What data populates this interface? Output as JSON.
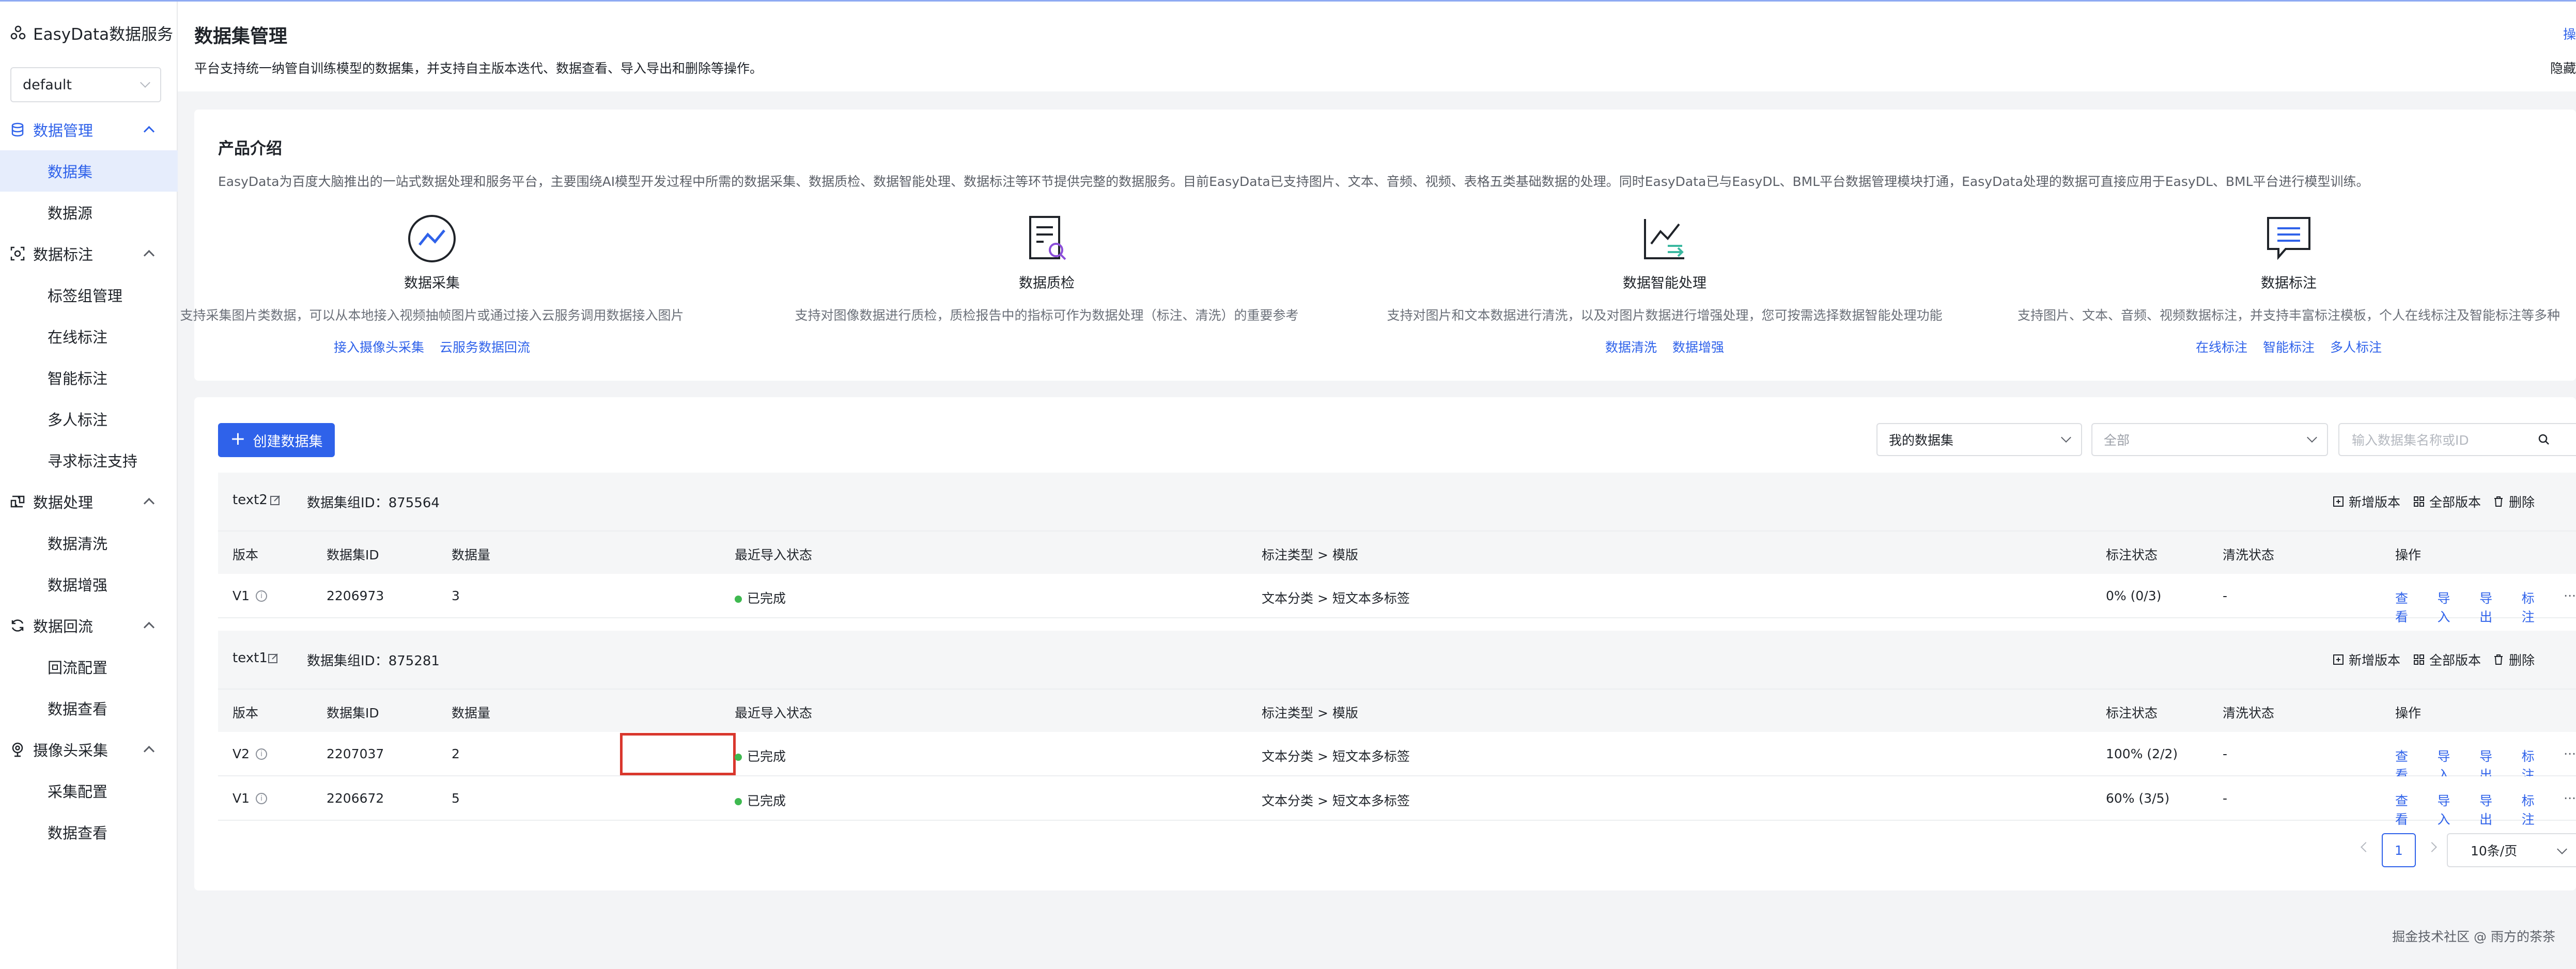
{
  "sidebar": {
    "brand": "EasyData数据服务",
    "workspace": "default",
    "groups": [
      {
        "label": "数据管理",
        "items": [
          "数据集",
          "数据源"
        ]
      },
      {
        "label": "数据标注",
        "items": [
          "标签组管理",
          "在线标注",
          "智能标注",
          "多人标注",
          "寻求标注支持"
        ]
      },
      {
        "label": "数据处理",
        "items": [
          "数据清洗",
          "数据增强"
        ]
      },
      {
        "label": "数据回流",
        "items": [
          "回流配置",
          "数据查看"
        ]
      },
      {
        "label": "摄像头采集",
        "items": [
          "采集配置",
          "数据查看"
        ]
      }
    ]
  },
  "header": {
    "title": "数据集管理",
    "description": "平台支持统一纳管自训练模型的数据集，并支持自主版本迭代、数据查看、导入导出和删除等操作。",
    "hide_link": "隐藏",
    "top_right": "操"
  },
  "intro": {
    "title": "产品介绍",
    "description": "EasyData为百度大脑推出的一站式数据处理和服务平台，主要围绕AI模型开发过程中所需的数据采集、数据质检、数据智能处理、数据标注等环节提供完整的数据服务。目前EasyData已支持图片、文本、音频、视频、表格五类基础数据的处理。同时EasyData已与EasyDL、BML平台数据管理模块打通，EasyData处理的数据可直接应用于EasyDL、BML平台进行模型训练。",
    "features": [
      {
        "name": "数据采集",
        "desc": "支持采集图片类数据，可以从本地接入视频抽帧图片或通过接入云服务调用数据接入图片",
        "links": [
          "接入摄像头采集",
          "云服务数据回流"
        ]
      },
      {
        "name": "数据质检",
        "desc": "支持对图像数据进行质检，质检报告中的指标可作为数据处理（标注、清洗）的重要参考",
        "links": []
      },
      {
        "name": "数据智能处理",
        "desc": "支持对图片和文本数据进行清洗，以及对图片数据进行增强处理，您可按需选择数据智能处理功能",
        "links": [
          "数据清洗",
          "数据增强"
        ]
      },
      {
        "name": "数据标注",
        "desc": "支持图片、文本、音频、视频数据标注，并支持丰富标注模板，个人在线标注及智能标注等多种",
        "links": [
          "在线标注",
          "智能标注",
          "多人标注"
        ]
      }
    ]
  },
  "toolbar": {
    "create_label": "创建数据集",
    "filter_mine": "我的数据集",
    "filter_all": "全部",
    "search_placeholder": "输入数据集名称或ID"
  },
  "columns": [
    "版本",
    "数据集ID",
    "数据量",
    "最近导入状态",
    "标注类型 > 模版",
    "标注状态",
    "清洗状态",
    "操作"
  ],
  "group_actions": [
    "新增版本",
    "全部版本",
    "删除"
  ],
  "row_actions": [
    "查看",
    "导入",
    "导出",
    "标注",
    "···"
  ],
  "datasets": [
    {
      "name": "text2",
      "group_id": "数据集组ID：875564",
      "rows": [
        {
          "version": "V1",
          "id": "2206973",
          "count": "3",
          "import_status": "已完成",
          "type": "文本分类 > 短文本多标签",
          "label_status": "0% (0/3)",
          "clean_status": "-"
        }
      ]
    },
    {
      "name": "text1",
      "group_id": "数据集组ID：875281",
      "rows": [
        {
          "version": "V2",
          "id": "2207037",
          "count": "2",
          "import_status": "已完成",
          "type": "文本分类 > 短文本多标签",
          "label_status": "100% (2/2)",
          "clean_status": "-"
        },
        {
          "version": "V1",
          "id": "2206672",
          "count": "5",
          "import_status": "已完成",
          "type": "文本分类 > 短文本多标签",
          "label_status": "60% (3/5)",
          "clean_status": "-"
        }
      ]
    }
  ],
  "pagination": {
    "page": "1",
    "page_size": "10条/页"
  },
  "watermark": "掘金技术社区 @ 雨方的茶茶"
}
